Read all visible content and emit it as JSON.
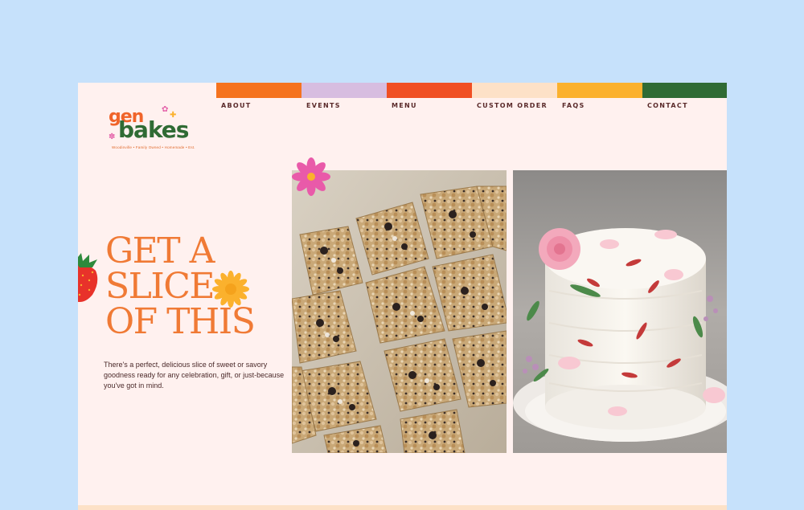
{
  "brand": {
    "logo_word1": "gen",
    "logo_word2": "bakes",
    "tagline": "Woodinville • Family Owned • Homemade • Est."
  },
  "nav": {
    "items": [
      {
        "label": "ABOUT",
        "color": "#f5731e"
      },
      {
        "label": "EVENTS",
        "color": "#d7bde0"
      },
      {
        "label": "MENU",
        "color": "#f04f23"
      },
      {
        "label": "CUSTOM ORDER",
        "color": "#fde1c7"
      },
      {
        "label": "FAQS",
        "color": "#fbb12d"
      },
      {
        "label": "CONTACT",
        "color": "#2f6b34"
      }
    ]
  },
  "hero": {
    "headline_line1": "GET A",
    "headline_line2": "SLICE",
    "headline_line3": "OF THIS",
    "blurb": "There's a perfect, delicious slice of sweet or savory goodness ready for any celebration, gift, or just-because you've got in mind."
  },
  "images": {
    "left": "cookies-and-cream-rice-krispie-treats",
    "right": "white-frosted-cake-with-flowers"
  },
  "colors": {
    "background": "#c6e1fb",
    "page": "#fff1ef",
    "accent_orange": "#f07a35",
    "green": "#2f6b34",
    "pink": "#e45fa8",
    "yellow": "#fbb12d"
  }
}
